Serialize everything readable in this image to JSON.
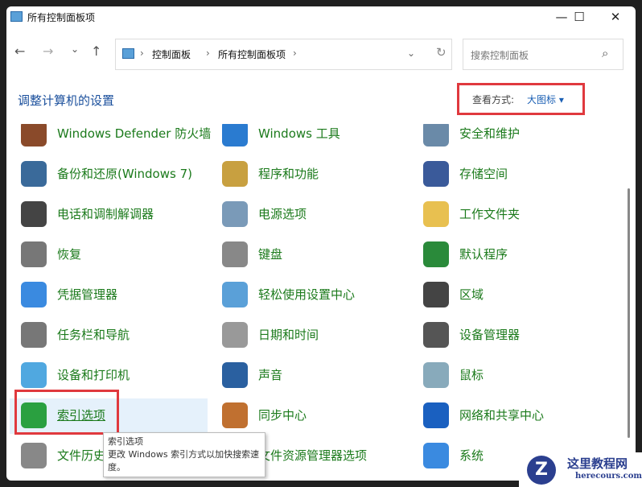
{
  "window": {
    "title": "所有控制面板项",
    "minimize": "—",
    "maximize": "☐",
    "close": "✕"
  },
  "nav": {
    "back": "←",
    "forward": "→",
    "recent": "⌄",
    "up": "↑"
  },
  "address": {
    "crumbs": [
      "控制面板",
      "所有控制面板项"
    ],
    "sep": "›",
    "dropdown": "⌄",
    "refresh": "↻"
  },
  "search": {
    "placeholder": "搜索控制面板",
    "icon": "⌕"
  },
  "heading": "调整计算机的设置",
  "view": {
    "label": "查看方式:",
    "value": "大图标 ▾"
  },
  "items": [
    [
      "Windows Defender 防火墙",
      "Windows 工具",
      "安全和维护"
    ],
    [
      "备份和还原(Windows 7)",
      "程序和功能",
      "存储空间"
    ],
    [
      "电话和调制解调器",
      "电源选项",
      "工作文件夹"
    ],
    [
      "恢复",
      "键盘",
      "默认程序"
    ],
    [
      "凭据管理器",
      "轻松使用设置中心",
      "区域"
    ],
    [
      "任务栏和导航",
      "日期和时间",
      "设备管理器"
    ],
    [
      "设备和打印机",
      "声音",
      "鼠标"
    ],
    [
      "索引选项",
      "同步中心",
      "网络和共享中心"
    ],
    [
      "文件历史记录",
      "文件资源管理器选项",
      "系统"
    ]
  ],
  "icon_colors": [
    "#8a4a2a",
    "#2a7bd0",
    "#6a8aa8",
    "#3a6a9a",
    "#c8a040",
    "#3a5a9a",
    "#444",
    "#7a9ab8",
    "#e8c050",
    "#777",
    "#888",
    "#2a8a3a",
    "#3a8ae0",
    "#5aa0d8",
    "#444",
    "#777",
    "#999",
    "#555",
    "#50a8e0",
    "#2a60a0",
    "#8ab",
    "#2aa040",
    "#c07030",
    "#1a60c0",
    "#888",
    "#e8a030",
    "#3a8ae0"
  ],
  "tooltip": {
    "title": "索引选项",
    "body": "更改 Windows 索引方式以加快搜索速度。"
  },
  "watermark": {
    "name": "这里教程网",
    "url": "herecours.com"
  }
}
